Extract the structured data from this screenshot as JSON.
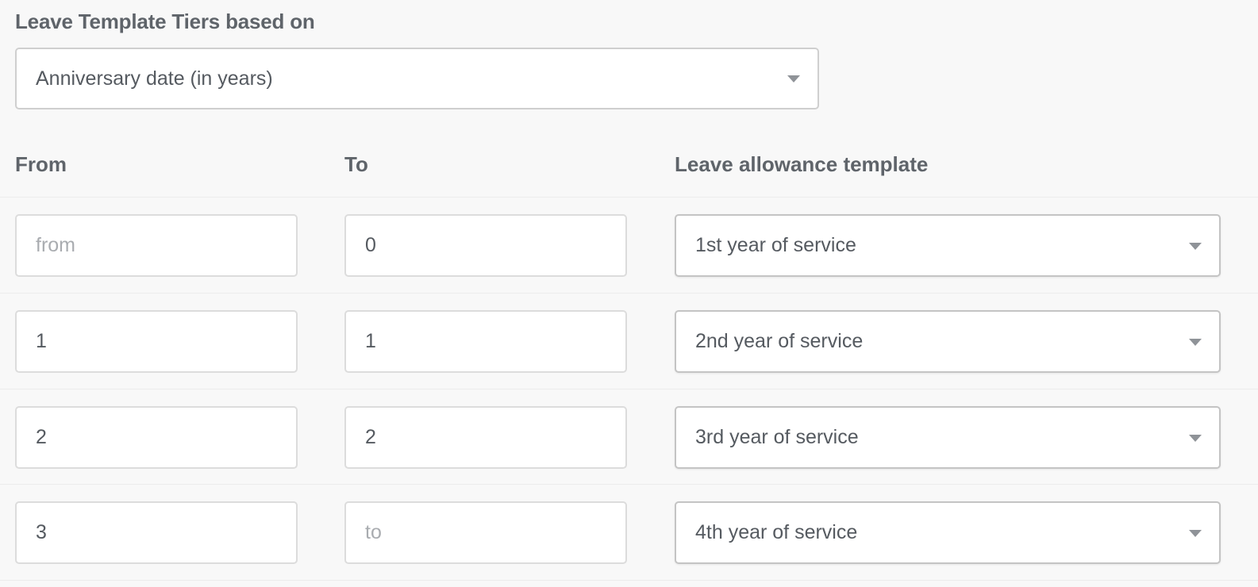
{
  "section": {
    "label": "Leave Template Tiers based on",
    "basis_select_value": "Anniversary date (in years)"
  },
  "columns": {
    "from": "From",
    "to": "To",
    "template": "Leave allowance template"
  },
  "placeholders": {
    "from": "from",
    "to": "to"
  },
  "tiers": [
    {
      "from": "",
      "to": "0",
      "template": "1st year of service"
    },
    {
      "from": "1",
      "to": "1",
      "template": "2nd year of service"
    },
    {
      "from": "2",
      "to": "2",
      "template": "3rd year of service"
    },
    {
      "from": "3",
      "to": "",
      "template": "4th year of service"
    }
  ],
  "colors": {
    "background": "#f8f8f8",
    "text": "#555a60",
    "placeholder": "#a9acb0",
    "border": "#cfcfcf"
  },
  "icons": {
    "select_caret": "chevron-down-icon"
  }
}
